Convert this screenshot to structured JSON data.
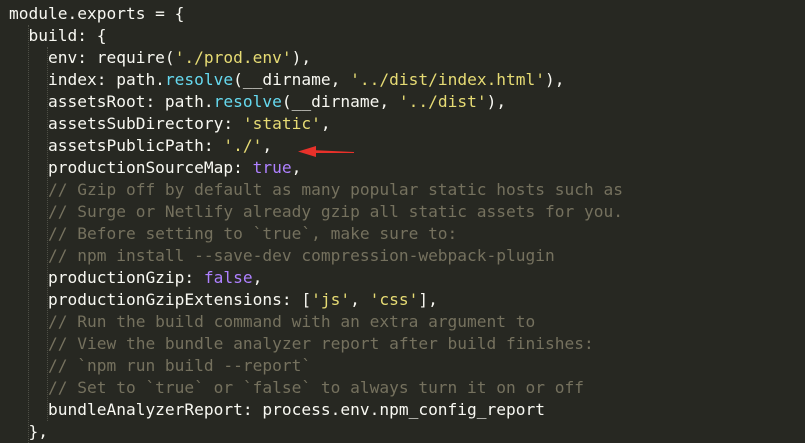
{
  "code": {
    "lines": [
      [
        {
          "t": "module.exports = {",
          "c": "plain"
        }
      ],
      [
        {
          "t": "  build: {",
          "c": "plain"
        }
      ],
      [
        {
          "t": "    env: require(",
          "c": "plain"
        },
        {
          "t": "'./prod.env'",
          "c": "str"
        },
        {
          "t": "),",
          "c": "plain"
        }
      ],
      [
        {
          "t": "    index: path.",
          "c": "plain"
        },
        {
          "t": "resolve",
          "c": "fn"
        },
        {
          "t": "(__dirname, ",
          "c": "plain"
        },
        {
          "t": "'../dist/index.html'",
          "c": "str"
        },
        {
          "t": "),",
          "c": "plain"
        }
      ],
      [
        {
          "t": "    assetsRoot: path.",
          "c": "plain"
        },
        {
          "t": "resolve",
          "c": "fn"
        },
        {
          "t": "(__dirname, ",
          "c": "plain"
        },
        {
          "t": "'../dist'",
          "c": "str"
        },
        {
          "t": "),",
          "c": "plain"
        }
      ],
      [
        {
          "t": "    assetsSubDirectory: ",
          "c": "plain"
        },
        {
          "t": "'static'",
          "c": "str"
        },
        {
          "t": ",",
          "c": "plain"
        }
      ],
      [
        {
          "t": "    assetsPublicPath: ",
          "c": "plain"
        },
        {
          "t": "'./'",
          "c": "str"
        },
        {
          "t": ",",
          "c": "plain"
        }
      ],
      [
        {
          "t": "    productionSourceMap: ",
          "c": "plain"
        },
        {
          "t": "true",
          "c": "bool"
        },
        {
          "t": ",",
          "c": "plain"
        }
      ],
      [
        {
          "t": "    // Gzip off by default as many popular static hosts such as",
          "c": "cm"
        }
      ],
      [
        {
          "t": "    // Surge or Netlify already gzip all static assets for you.",
          "c": "cm"
        }
      ],
      [
        {
          "t": "    // Before setting to `true`, make sure to:",
          "c": "cm"
        }
      ],
      [
        {
          "t": "    // npm install --save-dev compression-webpack-plugin",
          "c": "cm"
        }
      ],
      [
        {
          "t": "    productionGzip: ",
          "c": "plain"
        },
        {
          "t": "false",
          "c": "bool"
        },
        {
          "t": ",",
          "c": "plain"
        }
      ],
      [
        {
          "t": "    productionGzipExtensions: [",
          "c": "plain"
        },
        {
          "t": "'js'",
          "c": "str"
        },
        {
          "t": ", ",
          "c": "plain"
        },
        {
          "t": "'css'",
          "c": "str"
        },
        {
          "t": "],",
          "c": "plain"
        }
      ],
      [
        {
          "t": "    // Run the build command with an extra argument to",
          "c": "cm"
        }
      ],
      [
        {
          "t": "    // View the bundle analyzer report after build finishes:",
          "c": "cm"
        }
      ],
      [
        {
          "t": "    // `npm run build --report`",
          "c": "cm"
        }
      ],
      [
        {
          "t": "    // Set to `true` or `false` to always turn it on or off",
          "c": "cm"
        }
      ],
      [
        {
          "t": "    bundleAnalyzerReport: process.env.npm_config_report",
          "c": "plain"
        }
      ],
      [
        {
          "t": "  },",
          "c": "plain"
        }
      ]
    ]
  },
  "colors": {
    "background": "#272822",
    "plain": "#f8f8f2",
    "string": "#e6db74",
    "keyword": "#66d9ef",
    "boolean": "#ae81ff",
    "comment": "#75715e",
    "annotation_arrow": "#e8312a"
  },
  "annotation": {
    "icon": "red-arrow-icon",
    "points_to_line": 7
  }
}
